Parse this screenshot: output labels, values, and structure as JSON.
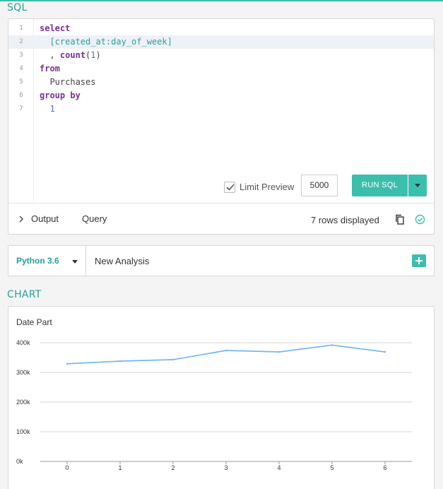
{
  "sections": {
    "sql": "SQL",
    "chart": "CHART"
  },
  "editor": {
    "lines": [
      {
        "num": "1",
        "tokens": [
          {
            "t": "select",
            "c": "kw"
          }
        ]
      },
      {
        "num": "2",
        "tokens": [
          {
            "t": "  ",
            "c": "ident"
          },
          {
            "t": "[created_at:day_of_week]",
            "c": "tmpl"
          }
        ]
      },
      {
        "num": "3",
        "tokens": [
          {
            "t": "  , ",
            "c": "ident"
          },
          {
            "t": "count",
            "c": "kw"
          },
          {
            "t": "(",
            "c": "ident"
          },
          {
            "t": "1",
            "c": "num"
          },
          {
            "t": ")",
            "c": "ident"
          }
        ]
      },
      {
        "num": "4",
        "tokens": [
          {
            "t": "from",
            "c": "kw"
          }
        ]
      },
      {
        "num": "5",
        "tokens": [
          {
            "t": "  Purchases",
            "c": "ident"
          }
        ]
      },
      {
        "num": "6",
        "tokens": [
          {
            "t": "group by",
            "c": "kw"
          }
        ]
      },
      {
        "num": "7",
        "tokens": [
          {
            "t": "  ",
            "c": "ident"
          },
          {
            "t": "1",
            "c": "num"
          }
        ]
      }
    ],
    "active_line": 1,
    "limit_preview_label": "Limit Preview",
    "limit_preview_checked": true,
    "limit_value": "5000",
    "run_label": "RUN SQL"
  },
  "output": {
    "tabs": [
      "Output",
      "Query"
    ],
    "rows_displayed": "7 rows displayed"
  },
  "python": {
    "version": "Python 3.6",
    "analysis_name": "New Analysis"
  },
  "colors": {
    "accent": "#3bbfad",
    "line": "#6cb3f5",
    "keyword": "#7a2e99"
  },
  "icons": {
    "copy": "copy-icon",
    "status": "check-circle-icon",
    "add": "plus-icon",
    "expand": "chevron-right-icon"
  },
  "chart_data": {
    "type": "line",
    "title": "Date Part",
    "x": [
      0,
      1,
      2,
      3,
      4,
      5,
      6
    ],
    "series": [
      {
        "values": [
          329000,
          338000,
          343000,
          374000,
          369000,
          392000,
          369000
        ]
      }
    ],
    "ylim": [
      0,
      400000
    ],
    "yticks": [
      0,
      100000,
      200000,
      300000,
      400000
    ],
    "ytick_labels": [
      "0k",
      "100k",
      "200k",
      "300k",
      "400k"
    ],
    "xtick_labels": [
      "0",
      "1",
      "2",
      "3",
      "4",
      "5",
      "6"
    ],
    "grid": true
  }
}
